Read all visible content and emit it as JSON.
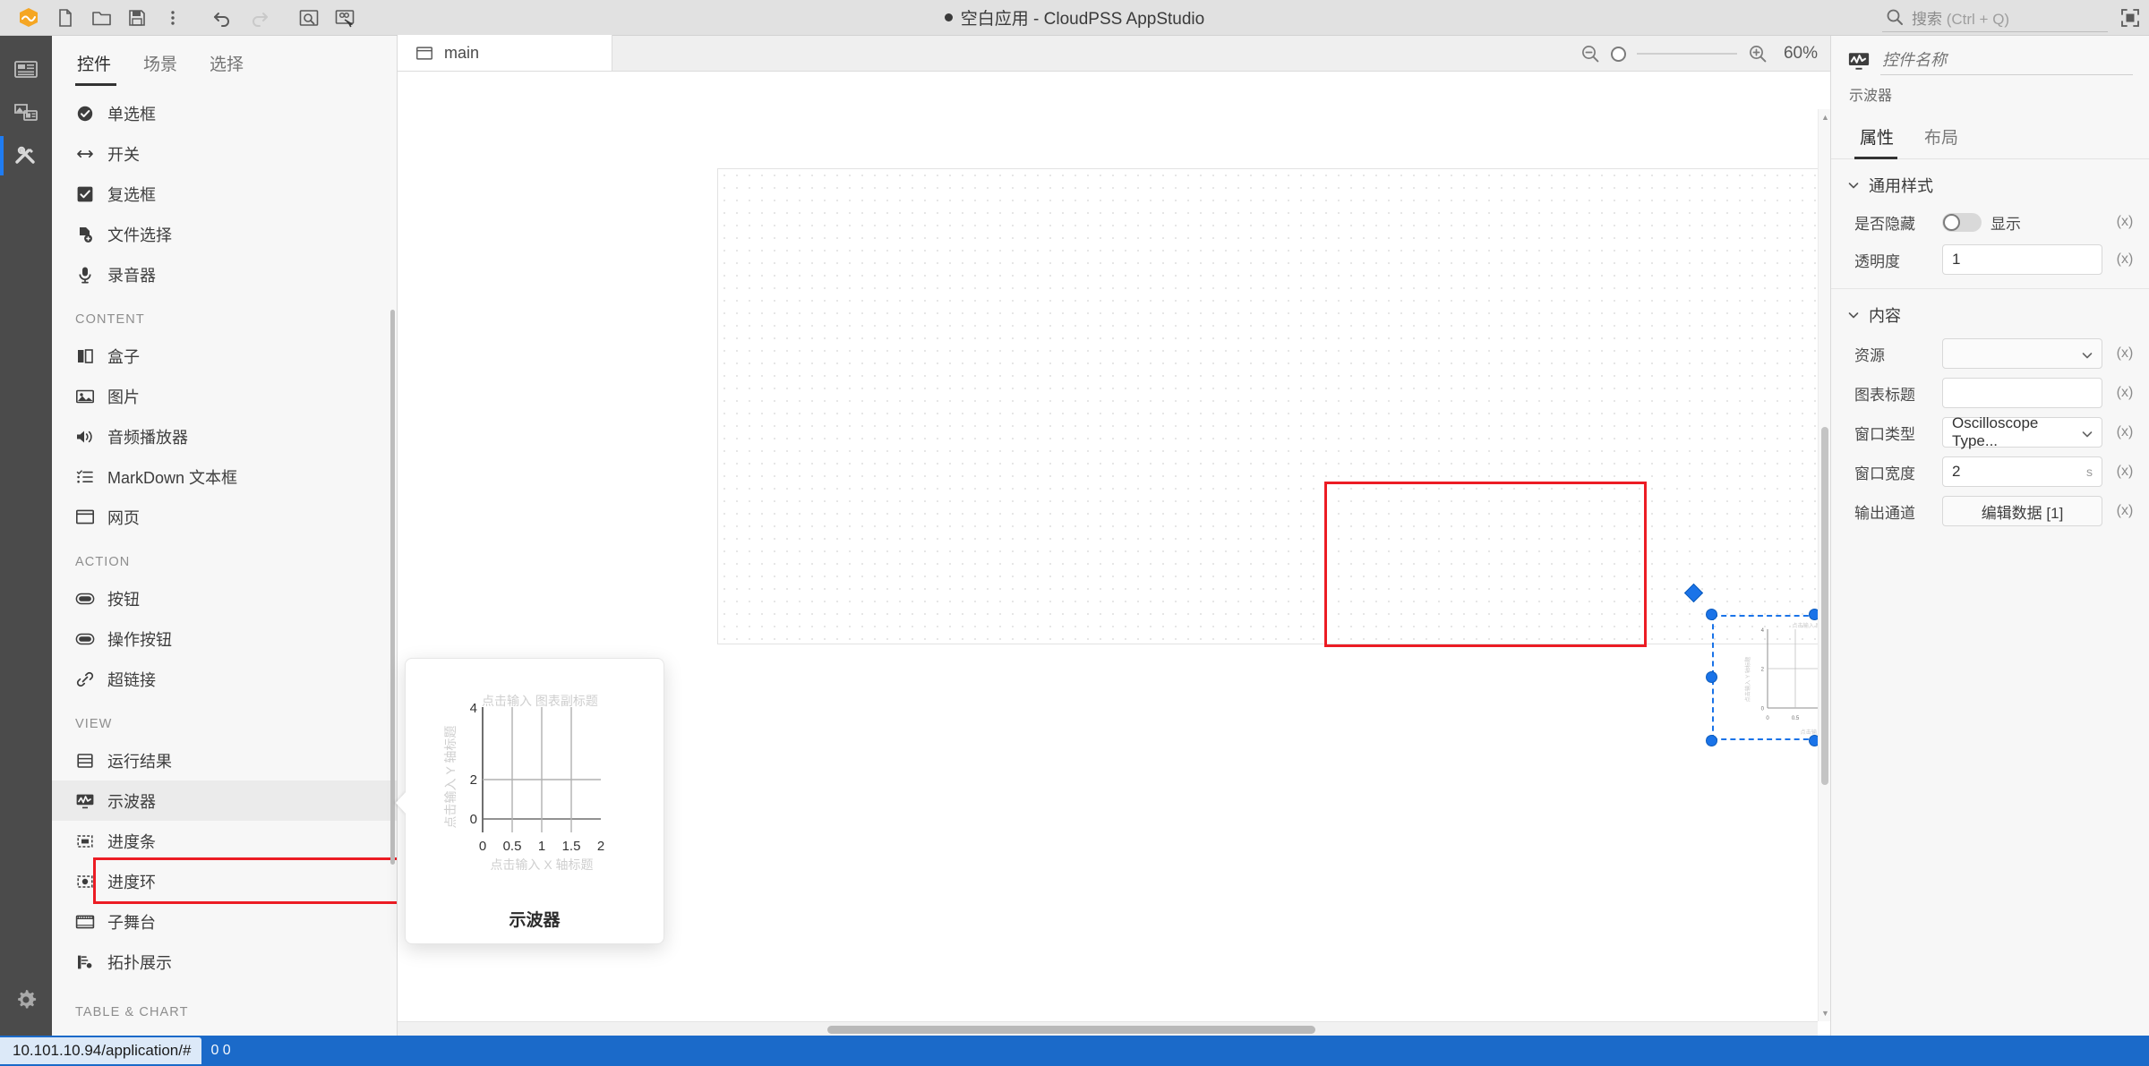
{
  "titlebar": {
    "title": "空白应用 - CloudPSS AppStudio",
    "buttons": [
      {
        "name": "app-logo-icon",
        "label": "CloudPSS"
      },
      {
        "name": "new-file-icon",
        "label": "新建"
      },
      {
        "name": "open-folder-icon",
        "label": "打开"
      },
      {
        "name": "save-icon",
        "label": "保存"
      },
      {
        "name": "more-vertical-icon",
        "label": "更多"
      },
      {
        "name": "undo-icon",
        "label": "撤销"
      },
      {
        "name": "redo-icon",
        "label": "重做"
      },
      {
        "name": "preview-icon",
        "label": "预览"
      },
      {
        "name": "publish-icon",
        "label": "发布"
      }
    ],
    "search_placeholder": "搜索",
    "search_hint": "(Ctrl + Q)",
    "fullscreen_label": "全屏"
  },
  "rail": {
    "items": [
      {
        "name": "sidebar-rail-layout",
        "icon": "layout-icon",
        "active": false
      },
      {
        "name": "sidebar-rail-media",
        "icon": "media-icon",
        "active": false
      },
      {
        "name": "sidebar-rail-tools",
        "icon": "tools-icon",
        "active": true
      }
    ],
    "settings_label": "设置"
  },
  "panel": {
    "tabs": [
      {
        "label": "控件",
        "active": true
      },
      {
        "label": "场景",
        "active": false
      },
      {
        "label": "选择",
        "active": false
      }
    ],
    "groups": [
      {
        "label": "",
        "items": [
          {
            "label": "单选框",
            "icon": "radio-icon"
          },
          {
            "label": "开关",
            "icon": "switch-icon"
          },
          {
            "label": "复选框",
            "icon": "checkbox-icon"
          },
          {
            "label": "文件选择",
            "icon": "file-picker-icon"
          },
          {
            "label": "录音器",
            "icon": "microphone-icon"
          }
        ]
      },
      {
        "label": "CONTENT",
        "items": [
          {
            "label": "盒子",
            "icon": "box-icon"
          },
          {
            "label": "图片",
            "icon": "image-icon"
          },
          {
            "label": "音频播放器",
            "icon": "speaker-icon"
          },
          {
            "label": "MarkDown 文本框",
            "icon": "list-icon"
          },
          {
            "label": "网页",
            "icon": "window-icon"
          }
        ]
      },
      {
        "label": "ACTION",
        "items": [
          {
            "label": "按钮",
            "icon": "button-icon"
          },
          {
            "label": "操作按钮",
            "icon": "button-icon"
          },
          {
            "label": "超链接",
            "icon": "link-icon"
          }
        ]
      },
      {
        "label": "VIEW",
        "items": [
          {
            "label": "运行结果",
            "icon": "result-icon"
          },
          {
            "label": "示波器",
            "icon": "oscilloscope-icon",
            "highlighted": true
          },
          {
            "label": "进度条",
            "icon": "progress-bar-icon"
          },
          {
            "label": "进度环",
            "icon": "progress-ring-icon"
          },
          {
            "label": "子舞台",
            "icon": "substage-icon"
          },
          {
            "label": "拓扑展示",
            "icon": "topology-icon"
          }
        ]
      }
    ],
    "bottom_group_label": "TABLE & CHART"
  },
  "editor": {
    "tab": {
      "label": "main",
      "icon": "window-icon"
    },
    "zoom": {
      "out_label": "缩小",
      "in_label": "放大",
      "percent": "60%",
      "slider_value": 0
    }
  },
  "preview_card": {
    "title": "示波器"
  },
  "chart_data": {
    "type": "line",
    "title": "点击输入 图表副标题",
    "xlabel": "点击输入 X 轴标题",
    "ylabel": "点击输入 Y 轴标题",
    "x_ticks": [
      "0",
      "0.5",
      "1",
      "1.5",
      "2"
    ],
    "y_ticks": [
      "0",
      "2",
      "4"
    ],
    "xlim": [
      0,
      2
    ],
    "ylim": [
      0,
      4
    ],
    "series": [],
    "grid": true,
    "legend": "none"
  },
  "props": {
    "name_placeholder": "控件名称",
    "type_label": "示波器",
    "icon": "oscilloscope-icon",
    "tabs": [
      {
        "label": "属性",
        "active": true
      },
      {
        "label": "布局",
        "active": false
      }
    ],
    "sections": [
      {
        "title": "通用样式",
        "expanded": true,
        "rows": [
          {
            "label": "是否隐藏",
            "control": "toggle",
            "value": "显示",
            "toggle_on": false,
            "expr": "(x)"
          },
          {
            "label": "透明度",
            "control": "input",
            "value": "1",
            "expr": "(x)"
          }
        ]
      },
      {
        "title": "内容",
        "expanded": true,
        "rows": [
          {
            "label": "资源",
            "control": "select",
            "value": "",
            "expr": "(x)"
          },
          {
            "label": "图表标题",
            "control": "input",
            "value": "",
            "expr": "(x)"
          },
          {
            "label": "窗口类型",
            "control": "select",
            "value": "Oscilloscope Type...",
            "expr": "(x)"
          },
          {
            "label": "窗口宽度",
            "control": "input",
            "value": "2",
            "unit": "s",
            "expr": "(x)"
          },
          {
            "label": "输出通道",
            "control": "button",
            "value": "编辑数据 [1]",
            "expr": "(x)"
          }
        ]
      }
    ]
  },
  "statusbar": {
    "url": "10.101.10.94/application/#",
    "right_text": "0 0"
  },
  "colors": {
    "accent_blue": "#1a73e8",
    "highlight_red": "#ec1c24",
    "status_blue": "#1b6ac9",
    "rail_dark": "#4b4b4b"
  }
}
